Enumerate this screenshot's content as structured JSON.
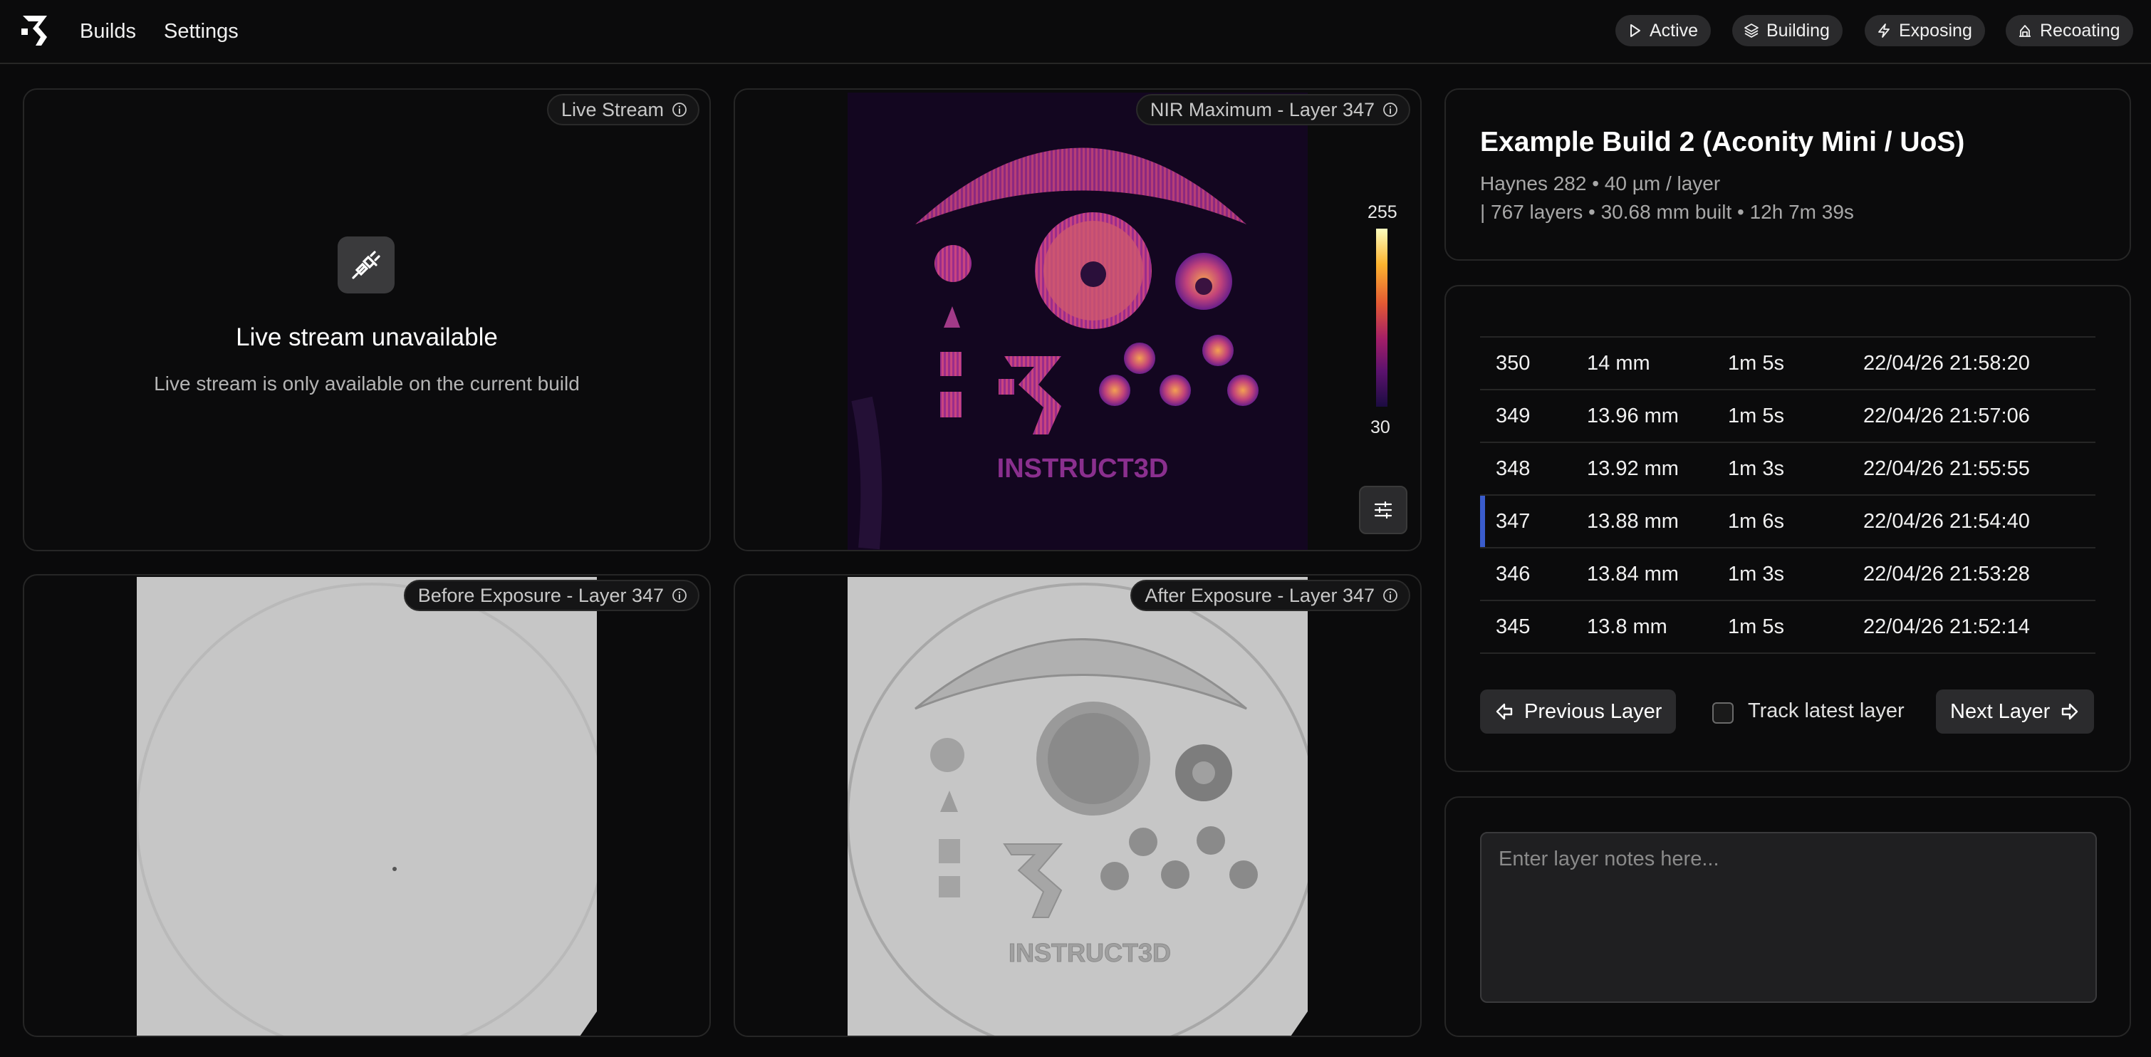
{
  "nav": {
    "builds": "Builds",
    "settings": "Settings",
    "status": [
      {
        "label": "Active",
        "icon": "play-icon"
      },
      {
        "label": "Building",
        "icon": "layers-icon"
      },
      {
        "label": "Exposing",
        "icon": "lightning-icon"
      },
      {
        "label": "Recoating",
        "icon": "recoater-icon"
      }
    ]
  },
  "panels": {
    "live_stream": {
      "tag": "Live Stream",
      "title": "Live stream unavailable",
      "subtitle": "Live stream is only available on the current build"
    },
    "nir": {
      "tag": "NIR Maximum - Layer 347",
      "colorbar_max": "255",
      "colorbar_min": "30",
      "colormap": [
        "#fcfdbf",
        "#fdb42f",
        "#e35933",
        "#a31e67",
        "#5c126e",
        "#1b0c41"
      ]
    },
    "before": {
      "tag": "Before Exposure - Layer 347"
    },
    "after": {
      "tag": "After Exposure - Layer 347"
    }
  },
  "build": {
    "title": "Example Build 2 (Aconity Mini / UoS)",
    "line1": "Haynes 282 • 40 µm / layer",
    "line2": "|  767 layers • 30.68 mm built • 12h 7m 39s"
  },
  "layers": {
    "rows": [
      {
        "layer": "350",
        "height": "14 mm",
        "duration": "1m 5s",
        "timestamp": "22/04/26 21:58:20"
      },
      {
        "layer": "349",
        "height": "13.96 mm",
        "duration": "1m 5s",
        "timestamp": "22/04/26 21:57:06"
      },
      {
        "layer": "348",
        "height": "13.92 mm",
        "duration": "1m 3s",
        "timestamp": "22/04/26 21:55:55"
      },
      {
        "layer": "347",
        "height": "13.88 mm",
        "duration": "1m 6s",
        "timestamp": "22/04/26 21:54:40"
      },
      {
        "layer": "346",
        "height": "13.84 mm",
        "duration": "1m 3s",
        "timestamp": "22/04/26 21:53:28"
      },
      {
        "layer": "345",
        "height": "13.8 mm",
        "duration": "1m 5s",
        "timestamp": "22/04/26 21:52:14"
      }
    ],
    "selected_layer": "347",
    "prev_label": "Previous Layer",
    "next_label": "Next Layer",
    "track_label": "Track latest layer",
    "track_checked": false,
    "accent": "#3a5ccc"
  },
  "notes": {
    "placeholder": "Enter layer notes here...",
    "value": ""
  }
}
